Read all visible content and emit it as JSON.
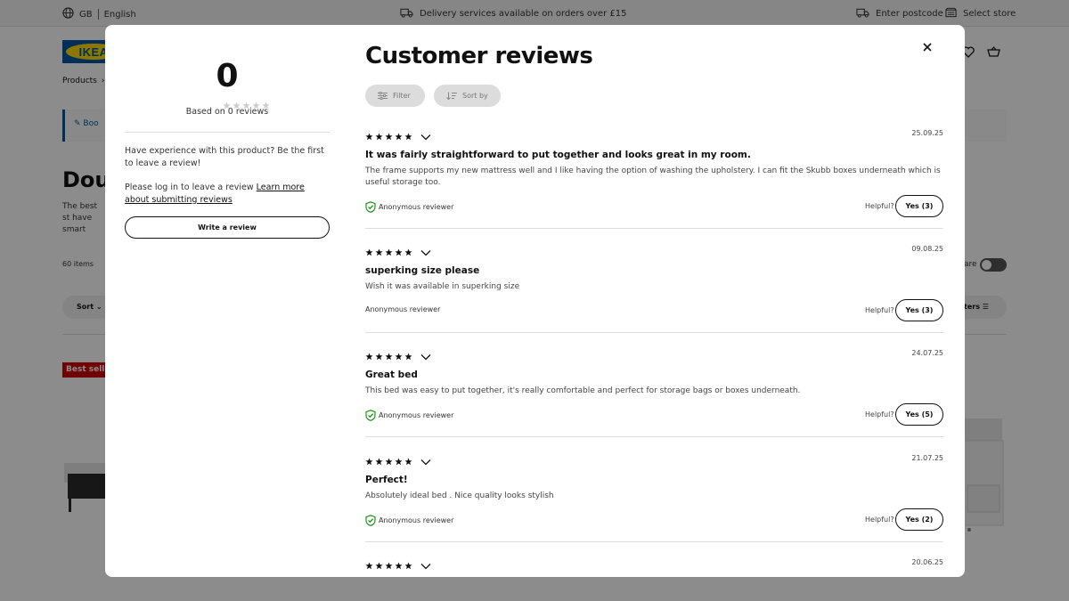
{
  "topbar": {
    "country": "GB",
    "language": "English",
    "delivery_text": "Delivery services available on orders over £15",
    "postcode_label": "Enter postcode",
    "store_label": "Select store"
  },
  "background": {
    "logo_text": "IKEA",
    "breadcrumb_first": "Products",
    "promo_text": "Boo",
    "page_title": "Dou",
    "desc_text": "The best st have smart double mat",
    "items_count": "60 items",
    "sort_label": "Sort",
    "compare_label": "are",
    "filters_label": "ters",
    "badge": "Best seller"
  },
  "summary": {
    "average": "0",
    "based_on": "Based on 0 reviews",
    "experience_text": "Have experience with this product? Be the first to leave a review!",
    "login_text": "Please log in to leave a review",
    "learn_more_link": "Learn more about submitting reviews",
    "write_review_label": "Write a review"
  },
  "reviews_panel": {
    "title": "Customer reviews",
    "filter_label": "Filter",
    "sort_label": "Sort by"
  },
  "reviews": [
    {
      "rating": 5,
      "date": "25.09.25",
      "title": "It was fairly straightforward to put together and looks great in my room.",
      "body": "The frame supports my new mattress well and I like having the option of washing the upholstery. I can fit the Skubb boxes underneath which is useful storage too.",
      "author": "Anonymous reviewer",
      "verified": true,
      "helpful_label": "Helpful?",
      "yes_label": "Yes (3)"
    },
    {
      "rating": 5,
      "date": "09.08.25",
      "title": "superking size please",
      "body": "Wish it was available in superking size",
      "author": "Anonymous reviewer",
      "verified": false,
      "helpful_label": "Helpful?",
      "yes_label": "Yes (3)"
    },
    {
      "rating": 5,
      "date": "24.07.25",
      "title": "Great bed",
      "body": "This bed was easy to put together, it's really comfortable and perfect for storage bags or boxes underneath.",
      "author": "Anonymous reviewer",
      "verified": true,
      "helpful_label": "Helpful?",
      "yes_label": "Yes (5)"
    },
    {
      "rating": 5,
      "date": "21.07.25",
      "title": "Perfect!",
      "body": "Absolutely ideal bed . Nice quality looks stylish",
      "author": "Anonymous reviewer",
      "verified": true,
      "helpful_label": "Helpful?",
      "yes_label": "Yes (2)"
    },
    {
      "rating": 5,
      "date": "20.06.25",
      "title": "",
      "body": "",
      "author": "",
      "verified": false,
      "helpful_label": "",
      "yes_label": ""
    }
  ],
  "colors": {
    "ikea_blue": "#0058a3",
    "ikea_yellow": "#ffdb00",
    "verified_green": "#0a8a00",
    "badge_red": "#cc0008"
  },
  "icons": {
    "globe": "globe-icon",
    "truck": "truck-icon",
    "store": "store-icon",
    "close": "close-icon",
    "filter": "filter-icon",
    "sort": "sort-icon",
    "star": "star-icon",
    "chevron": "chevron-down-icon",
    "verified": "shield-check-icon"
  }
}
